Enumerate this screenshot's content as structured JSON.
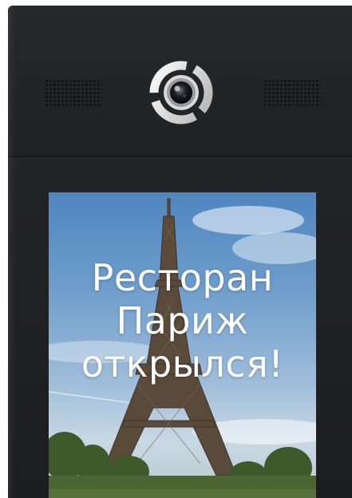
{
  "promo": {
    "line1": "Ресторан",
    "line2": "Париж",
    "line3": "открылся!"
  },
  "device": {
    "body_color": "#222325",
    "icons": [
      "speaker-grille-icon",
      "camera-icon",
      "eiffel-tower-image"
    ]
  }
}
